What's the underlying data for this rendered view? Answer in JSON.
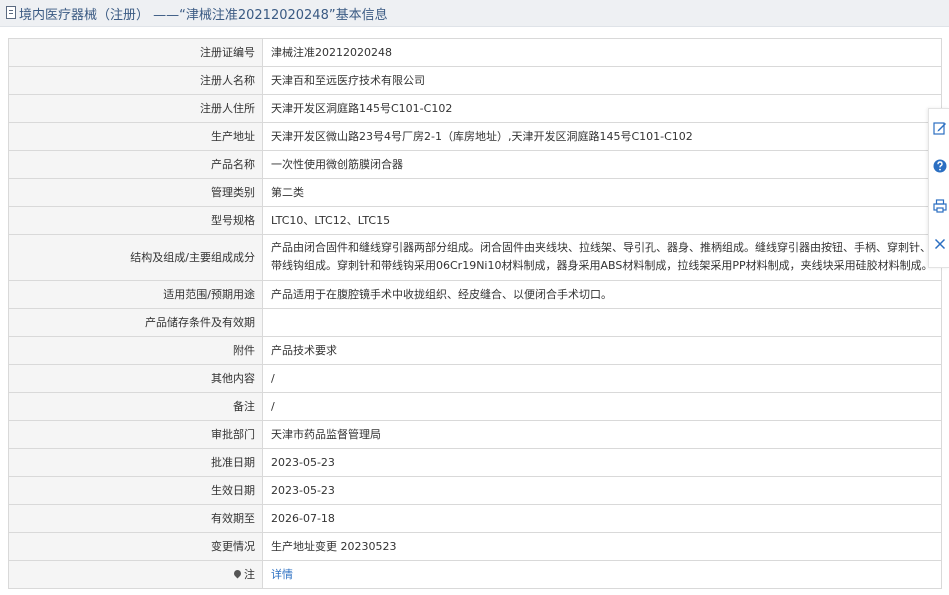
{
  "header": {
    "title": "境内医疗器械（注册） ——“津械注准20212020248”基本信息"
  },
  "rows": [
    {
      "label": "注册证编号",
      "value": "津械注准20212020248"
    },
    {
      "label": "注册人名称",
      "value": "天津百和至远医疗技术有限公司"
    },
    {
      "label": "注册人住所",
      "value": "天津开发区洞庭路145号C101-C102"
    },
    {
      "label": "生产地址",
      "value": "天津开发区微山路23号4号厂房2-1（库房地址）,天津开发区洞庭路145号C101-C102"
    },
    {
      "label": "产品名称",
      "value": "一次性使用微创筋膜闭合器"
    },
    {
      "label": "管理类别",
      "value": "第二类"
    },
    {
      "label": "型号规格",
      "value": "LTC10、LTC12、LTC15"
    },
    {
      "label": "结构及组成/主要组成成分",
      "value": "产品由闭合固件和缝线穿引器两部分组成。闭合固件由夹线块、拉线架、导引孔、器身、推柄组成。缝线穿引器由按钮、手柄、穿刺针、带线钩组成。穿刺针和带线钩采用06Cr19Ni10材料制成，器身采用ABS材料制成，拉线架采用PP材料制成，夹线块采用硅胶材料制成。"
    },
    {
      "label": "适用范围/预期用途",
      "value": "产品适用于在腹腔镜手术中收拢组织、经皮缝合、以便闭合手术切口。"
    },
    {
      "label": "产品储存条件及有效期",
      "value": ""
    },
    {
      "label": "附件",
      "value": "产品技术要求"
    },
    {
      "label": "其他内容",
      "value": "/"
    },
    {
      "label": "备注",
      "value": "/"
    },
    {
      "label": "审批部门",
      "value": "天津市药品监督管理局"
    },
    {
      "label": "批准日期",
      "value": "2023-05-23"
    },
    {
      "label": "生效日期",
      "value": "2023-05-23"
    },
    {
      "label": "有效期至",
      "value": "2026-07-18"
    },
    {
      "label": "变更情况",
      "value": "生产地址变更 20230523"
    }
  ],
  "note": {
    "label": "注",
    "link": "详情"
  },
  "colors": {
    "header_bg": "#eef0f3",
    "title": "#3a5a83",
    "label_bg": "#f5f5f5",
    "border": "#d9d9d9",
    "link": "#2b6fc2",
    "toolbar_icon": "#2b6fc2"
  },
  "toolbar": {
    "icons": [
      "edit-icon",
      "help-icon",
      "print-icon",
      "close-icon"
    ]
  }
}
